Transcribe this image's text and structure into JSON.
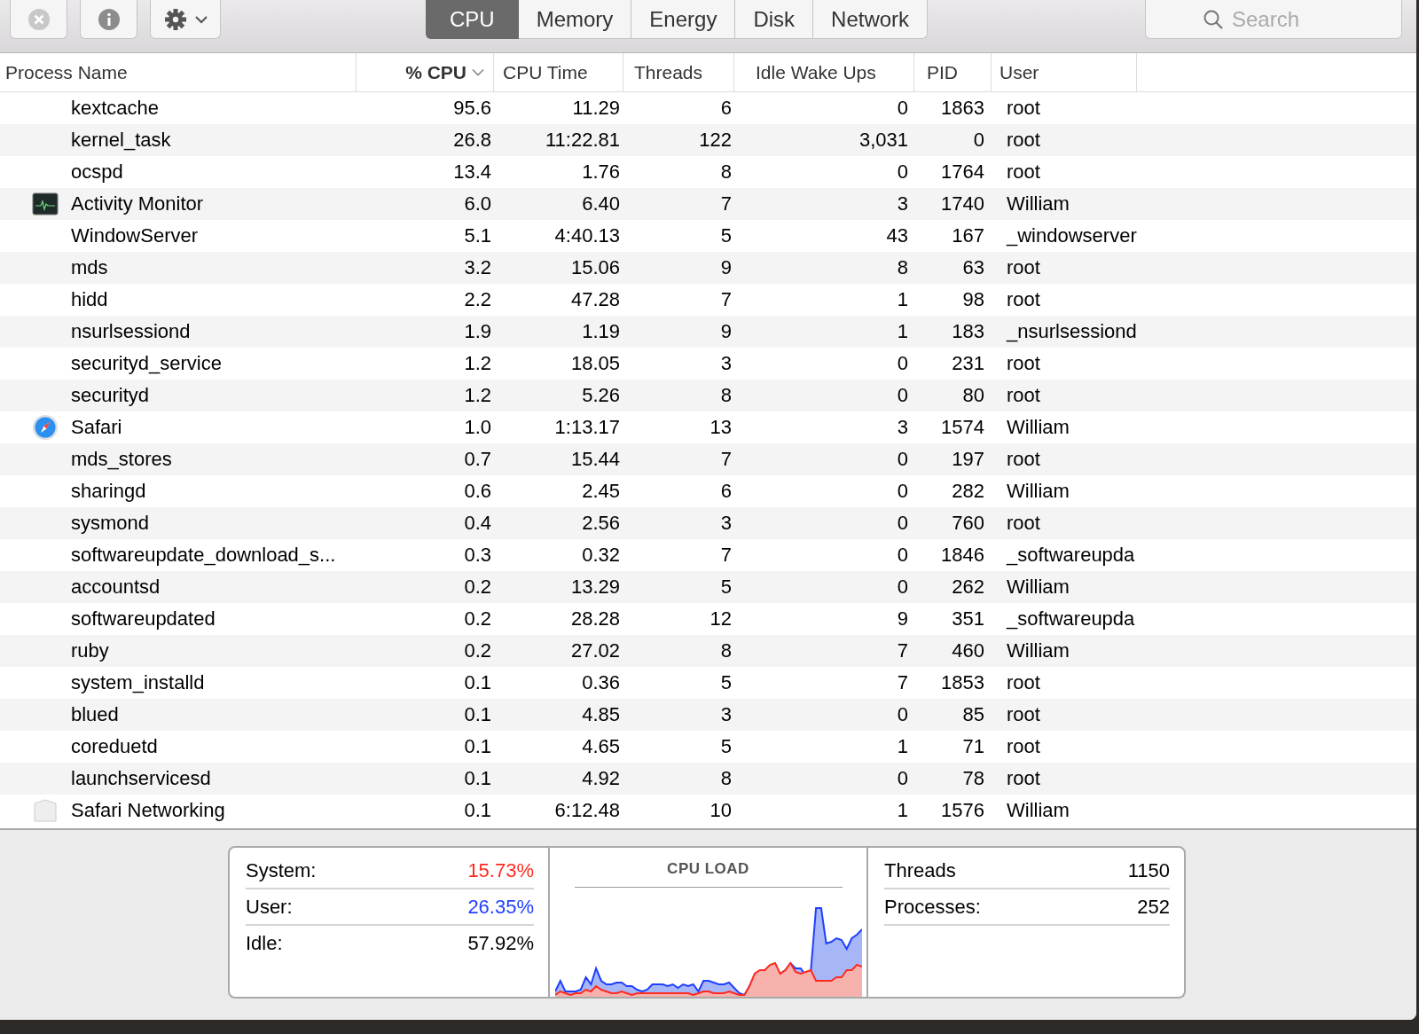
{
  "toolbar": {
    "tabs": [
      {
        "label": "CPU",
        "selected": true
      },
      {
        "label": "Memory",
        "selected": false
      },
      {
        "label": "Energy",
        "selected": false
      },
      {
        "label": "Disk",
        "selected": false
      },
      {
        "label": "Network",
        "selected": false
      }
    ],
    "search": {
      "placeholder": "Search"
    }
  },
  "table": {
    "columns": [
      {
        "label": "Process Name",
        "sorted": false
      },
      {
        "label": "% CPU",
        "sorted": true
      },
      {
        "label": "CPU Time",
        "sorted": false
      },
      {
        "label": "Threads",
        "sorted": false
      },
      {
        "label": "Idle Wake Ups",
        "sorted": false
      },
      {
        "label": "PID",
        "sorted": false
      },
      {
        "label": "User",
        "sorted": false
      }
    ],
    "rows": [
      {
        "kind": "plain",
        "name": "kextcache",
        "cpu": "95.6",
        "time": "11.29",
        "threads": "6",
        "idle": "0",
        "pid": "1863",
        "user": "root"
      },
      {
        "kind": "plain",
        "name": "kernel_task",
        "cpu": "26.8",
        "time": "11:22.81",
        "threads": "122",
        "idle": "3,031",
        "pid": "0",
        "user": "root"
      },
      {
        "kind": "plain",
        "name": "ocspd",
        "cpu": "13.4",
        "time": "1.76",
        "threads": "8",
        "idle": "0",
        "pid": "1764",
        "user": "root"
      },
      {
        "kind": "monitor",
        "name": "Activity Monitor",
        "cpu": "6.0",
        "time": "6.40",
        "threads": "7",
        "idle": "3",
        "pid": "1740",
        "user": "William"
      },
      {
        "kind": "plain",
        "name": "WindowServer",
        "cpu": "5.1",
        "time": "4:40.13",
        "threads": "5",
        "idle": "43",
        "pid": "167",
        "user": "_windowserver"
      },
      {
        "kind": "plain",
        "name": "mds",
        "cpu": "3.2",
        "time": "15.06",
        "threads": "9",
        "idle": "8",
        "pid": "63",
        "user": "root"
      },
      {
        "kind": "plain",
        "name": "hidd",
        "cpu": "2.2",
        "time": "47.28",
        "threads": "7",
        "idle": "1",
        "pid": "98",
        "user": "root"
      },
      {
        "kind": "plain",
        "name": "nsurlsessiond",
        "cpu": "1.9",
        "time": "1.19",
        "threads": "9",
        "idle": "1",
        "pid": "183",
        "user": "_nsurlsessiond"
      },
      {
        "kind": "plain",
        "name": "securityd_service",
        "cpu": "1.2",
        "time": "18.05",
        "threads": "3",
        "idle": "0",
        "pid": "231",
        "user": "root"
      },
      {
        "kind": "plain",
        "name": "securityd",
        "cpu": "1.2",
        "time": "5.26",
        "threads": "8",
        "idle": "0",
        "pid": "80",
        "user": "root"
      },
      {
        "kind": "browser",
        "name": "Safari",
        "cpu": "1.0",
        "time": "1:13.17",
        "threads": "13",
        "idle": "3",
        "pid": "1574",
        "user": "William"
      },
      {
        "kind": "plain",
        "name": "mds_stores",
        "cpu": "0.7",
        "time": "15.44",
        "threads": "7",
        "idle": "0",
        "pid": "197",
        "user": "root"
      },
      {
        "kind": "plain",
        "name": "sharingd",
        "cpu": "0.6",
        "time": "2.45",
        "threads": "6",
        "idle": "0",
        "pid": "282",
        "user": "William"
      },
      {
        "kind": "plain",
        "name": "sysmond",
        "cpu": "0.4",
        "time": "2.56",
        "threads": "3",
        "idle": "0",
        "pid": "760",
        "user": "root"
      },
      {
        "kind": "plain",
        "name": "softwareupdate_download_s...",
        "cpu": "0.3",
        "time": "0.32",
        "threads": "7",
        "idle": "0",
        "pid": "1846",
        "user": "_softwareupda"
      },
      {
        "kind": "plain",
        "name": "accountsd",
        "cpu": "0.2",
        "time": "13.29",
        "threads": "5",
        "idle": "0",
        "pid": "262",
        "user": "William"
      },
      {
        "kind": "plain",
        "name": "softwareupdated",
        "cpu": "0.2",
        "time": "28.28",
        "threads": "12",
        "idle": "9",
        "pid": "351",
        "user": "_softwareupda"
      },
      {
        "kind": "plain",
        "name": "ruby",
        "cpu": "0.2",
        "time": "27.02",
        "threads": "8",
        "idle": "7",
        "pid": "460",
        "user": "William"
      },
      {
        "kind": "plain",
        "name": "system_installd",
        "cpu": "0.1",
        "time": "0.36",
        "threads": "5",
        "idle": "7",
        "pid": "1853",
        "user": "root"
      },
      {
        "kind": "plain",
        "name": "blued",
        "cpu": "0.1",
        "time": "4.85",
        "threads": "3",
        "idle": "0",
        "pid": "85",
        "user": "root"
      },
      {
        "kind": "plain",
        "name": "coreduetd",
        "cpu": "0.1",
        "time": "4.65",
        "threads": "5",
        "idle": "1",
        "pid": "71",
        "user": "root"
      },
      {
        "kind": "plain",
        "name": "launchservicesd",
        "cpu": "0.1",
        "time": "4.92",
        "threads": "8",
        "idle": "0",
        "pid": "78",
        "user": "root"
      },
      {
        "kind": "service",
        "name": "Safari Networking",
        "cpu": "0.1",
        "time": "6:12.48",
        "threads": "10",
        "idle": "1",
        "pid": "1576",
        "user": "William"
      }
    ]
  },
  "summary": {
    "stats": [
      {
        "label": "System:",
        "value": "15.73%",
        "color": "#ff2a1f"
      },
      {
        "label": "User:",
        "value": "26.35%",
        "color": "#1f3fff"
      },
      {
        "label": "Idle:",
        "value": "57.92%",
        "color": "#000000"
      }
    ],
    "chart_title": "CPU LOAD",
    "counts": [
      {
        "label": "Threads",
        "value": "1150"
      },
      {
        "label": "Processes:",
        "value": "252"
      }
    ]
  }
}
